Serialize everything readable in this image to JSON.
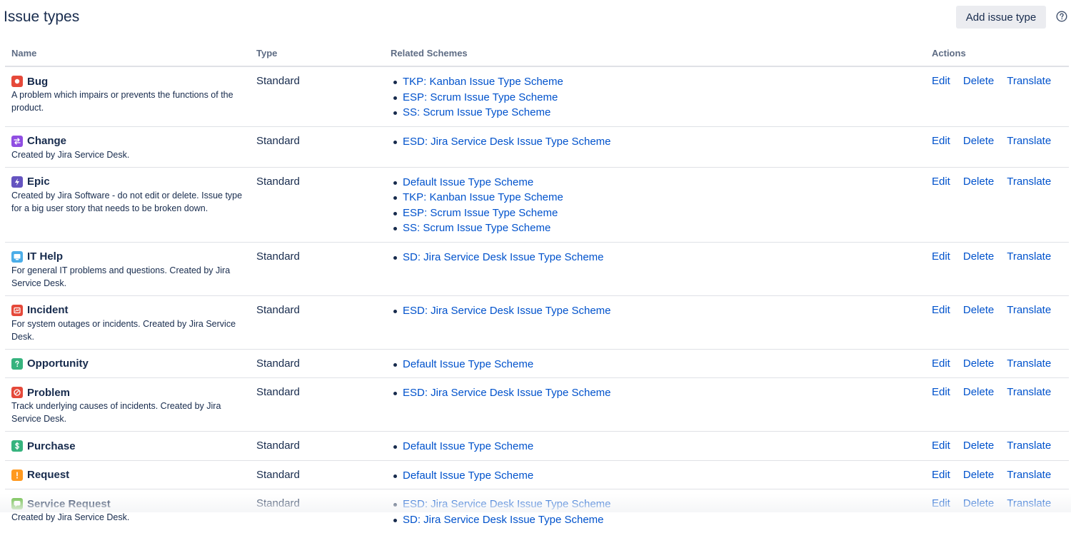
{
  "page": {
    "title": "Issue types",
    "add_button_label": "Add issue type",
    "help_icon": "help-circle-icon"
  },
  "table": {
    "headers": {
      "name": "Name",
      "type": "Type",
      "schemes": "Related Schemes",
      "actions": "Actions"
    },
    "action_labels": {
      "edit": "Edit",
      "delete": "Delete",
      "translate": "Translate"
    },
    "rows": [
      {
        "name": "Bug",
        "icon": "bug-icon",
        "color": "#e5493a",
        "description": "A problem which impairs or prevents the functions of the product.",
        "type": "Standard",
        "schemes": [
          "TKP: Kanban Issue Type Scheme",
          "ESP: Scrum Issue Type Scheme",
          "SS: Scrum Issue Type Scheme"
        ]
      },
      {
        "name": "Change",
        "icon": "change-icon",
        "color": "#904ee2",
        "description": "Created by Jira Service Desk.",
        "type": "Standard",
        "schemes": [
          "ESD: Jira Service Desk Issue Type Scheme"
        ]
      },
      {
        "name": "Epic",
        "icon": "epic-icon",
        "color": "#6554c0",
        "description": "Created by Jira Software - do not edit or delete. Issue type for a big user story that needs to be broken down.",
        "type": "Standard",
        "schemes": [
          "Default Issue Type Scheme",
          "TKP: Kanban Issue Type Scheme",
          "ESP: Scrum Issue Type Scheme",
          "SS: Scrum Issue Type Scheme"
        ]
      },
      {
        "name": "IT Help",
        "icon": "it-help-icon",
        "color": "#4bade8",
        "description": "For general IT problems and questions. Created by Jira Service Desk.",
        "type": "Standard",
        "schemes": [
          "SD: Jira Service Desk Issue Type Scheme"
        ]
      },
      {
        "name": "Incident",
        "icon": "incident-icon",
        "color": "#e5493a",
        "description": "For system outages or incidents. Created by Jira Service Desk.",
        "type": "Standard",
        "schemes": [
          "ESD: Jira Service Desk Issue Type Scheme"
        ]
      },
      {
        "name": "Opportunity",
        "icon": "opportunity-icon",
        "color": "#36b37e",
        "description": "",
        "type": "Standard",
        "schemes": [
          "Default Issue Type Scheme"
        ]
      },
      {
        "name": "Problem",
        "icon": "problem-icon",
        "color": "#e5493a",
        "description": "Track underlying causes of incidents. Created by Jira Service Desk.",
        "type": "Standard",
        "schemes": [
          "ESD: Jira Service Desk Issue Type Scheme"
        ]
      },
      {
        "name": "Purchase",
        "icon": "purchase-icon",
        "color": "#36b37e",
        "description": "",
        "type": "Standard",
        "schemes": [
          "Default Issue Type Scheme"
        ]
      },
      {
        "name": "Request",
        "icon": "request-icon",
        "color": "#ff991f",
        "description": "",
        "type": "Standard",
        "schemes": [
          "Default Issue Type Scheme"
        ]
      },
      {
        "name": "Service Request",
        "icon": "service-request-icon",
        "color": "#63ba3c",
        "description": "Created by Jira Service Desk.",
        "type": "Standard",
        "schemes": [
          "ESD: Jira Service Desk Issue Type Scheme",
          "SD: Jira Service Desk Issue Type Scheme"
        ]
      }
    ]
  }
}
